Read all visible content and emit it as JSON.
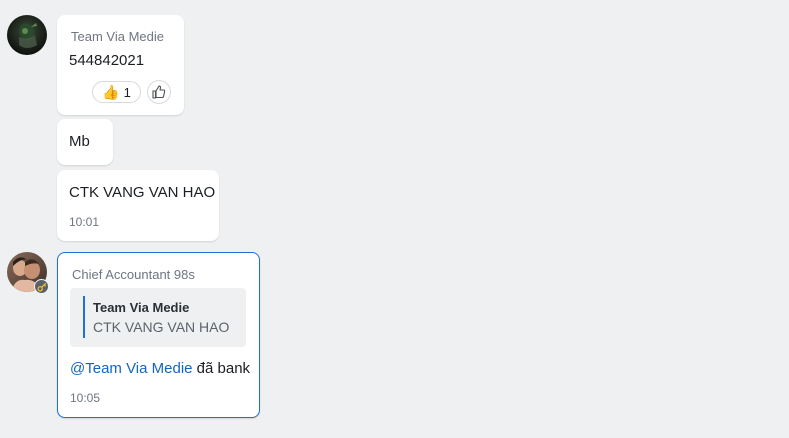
{
  "messages": [
    {
      "sender": "Team Via Medie",
      "text": "544842021",
      "reaction": {
        "emoji": "👍",
        "count": "1"
      }
    },
    {
      "text": "Mb"
    },
    {
      "text": "CTK VANG VAN HAO",
      "time": "10:01"
    }
  ],
  "reply": {
    "sender": "Chief Accountant 98s",
    "quote": {
      "author": "Team Via Medie",
      "text": "CTK VANG VAN HAO"
    },
    "mention": "@Team Via Medie",
    "text": " đã bank",
    "time": "10:05"
  },
  "icons": {
    "reaction_emoji": "thumbs-up-emoji",
    "add_reaction": "thumbs-up-outline-icon",
    "badge": "key-icon"
  },
  "colors": {
    "accent": "#1f6fd6",
    "mention": "#1565c0",
    "background": "#eef0f1"
  }
}
